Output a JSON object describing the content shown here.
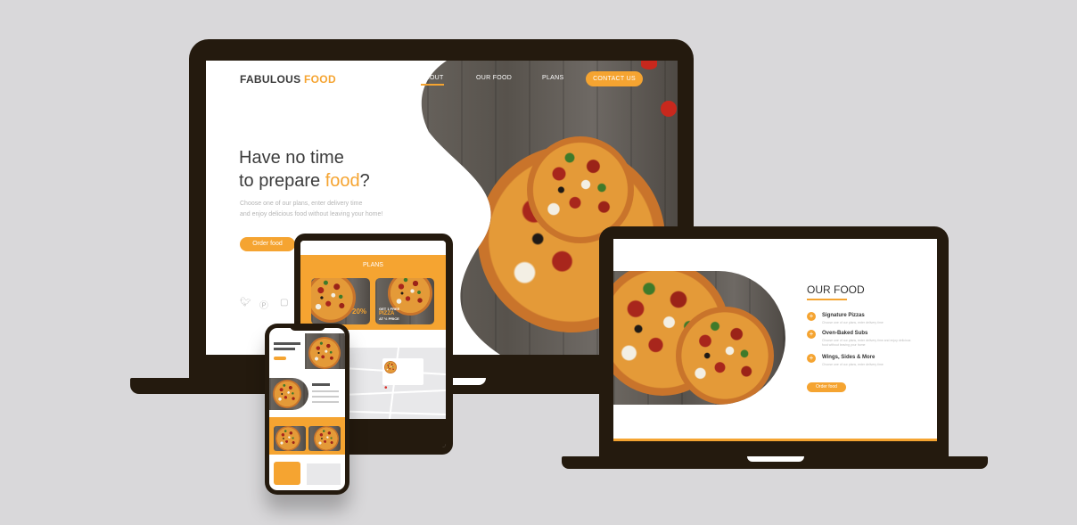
{
  "desktop": {
    "logo_main": "FABULOUS",
    "logo_accent": "FOOD",
    "nav": {
      "about": "ABOUT",
      "our_food": "OUR FOOD",
      "plans": "PLANS",
      "contact": "CONTACT US"
    },
    "hero_line1": "Have no time",
    "hero_line2_prefix": "to prepare ",
    "hero_line2_accent": "food",
    "hero_line2_suffix": "?",
    "hero_text_1": "Choose one of our plans, enter delivery time",
    "hero_text_2": "and enjoy delicious food without leaving your home!",
    "order_button": "Order food",
    "social_icons": [
      "twitter-icon",
      "pinterest-icon",
      "instagram-icon"
    ]
  },
  "tablet": {
    "plans_title": "PLANS",
    "promo_1": "20%",
    "promo_2_line1": "GET 1 FREE",
    "promo_2_line2": "PIZZA",
    "promo_2_line3": "AT ½ PRICE"
  },
  "second_laptop": {
    "title": "OUR FOOD",
    "items": [
      {
        "title": "Signature Pizzas",
        "text": "Choose one of our plans, enter delivery time"
      },
      {
        "title": "Oven-Baked Subs",
        "text": "Choose one of our plans, enter delivery time and enjoy delicious food without leaving your home"
      },
      {
        "title": "Wings, Sides & More",
        "text": "Choose one of our plans, enter delivery time"
      }
    ],
    "order_button": "Order food"
  },
  "colors": {
    "accent": "#f5a431",
    "device_frame": "#241a0e",
    "background": "#d9d8da"
  }
}
